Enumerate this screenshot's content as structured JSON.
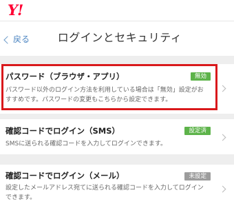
{
  "header": {
    "logo": "Y!",
    "back_label": "戻る",
    "title": "ログインとセキュリティ"
  },
  "items": [
    {
      "title": "パスワード（ブラウザ・アプリ）",
      "badge": "無効",
      "badge_color": "#5db34a",
      "description": "パスワード以外のログイン方法を利用している場合は「無効」設定がおすすめです。パスワードの変更もこちらから設定できます。",
      "highlighted": true
    },
    {
      "title": "確認コードでログイン（SMS）",
      "badge": "設定済",
      "badge_color": "#5db34a",
      "description": "SMSに送られる確認コードを入力してログインできます。"
    },
    {
      "title": "確認コードでログイン（メール）",
      "badge": "未設定",
      "badge_color": "#9c9c9c",
      "description": "設定したメールアドレス宛てに送られる確認コードを入力してログインできます。"
    }
  ],
  "colors": {
    "brand": "#ff0033",
    "highlight_border": "#d9181b",
    "link": "#4d86c2"
  }
}
